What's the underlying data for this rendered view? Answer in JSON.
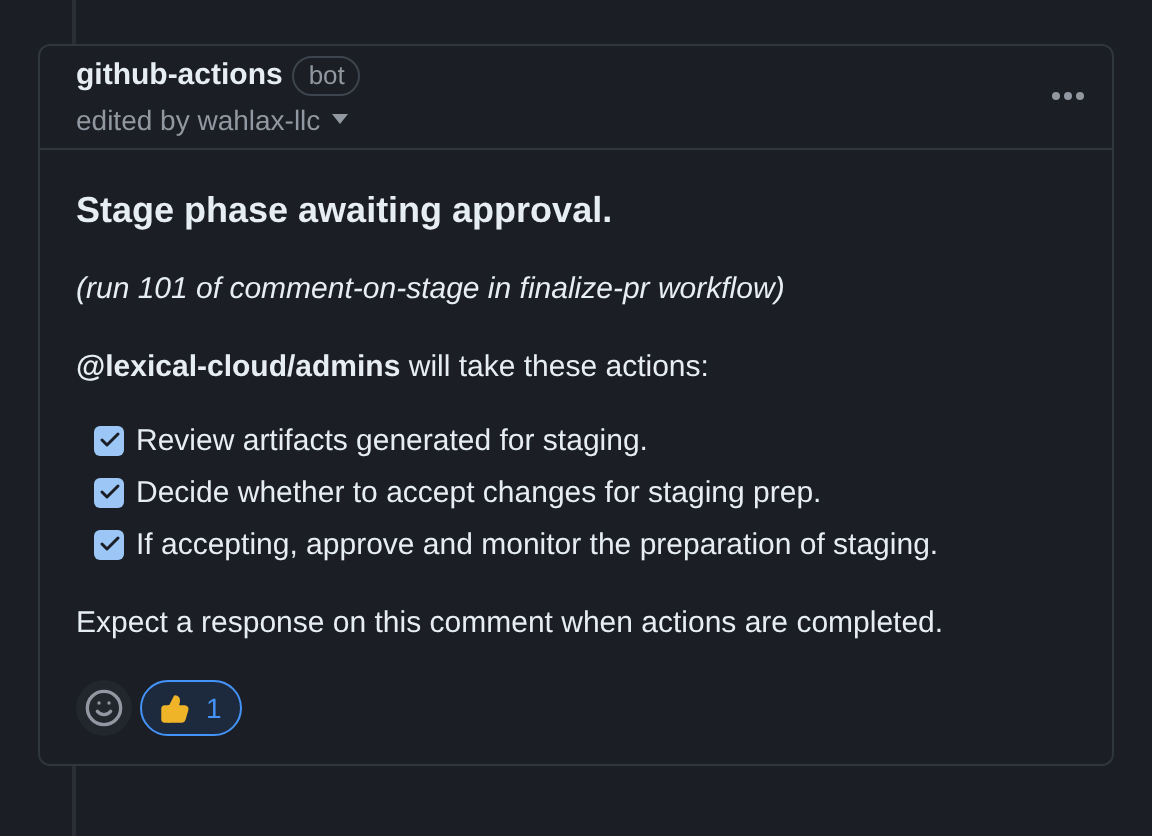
{
  "comment": {
    "author": "github-actions",
    "badge": "bot",
    "edited": "edited by wahlax-llc",
    "title": "Stage phase awaiting approval.",
    "run_note": "(run 101 of comment-on-stage in finalize-pr workflow)",
    "intro": "**@lexical-cloud/admins** will take these actions:",
    "tasks": [
      {
        "label": "Review artifacts generated for staging.",
        "checked": true
      },
      {
        "label": "Decide whether to accept changes for staging prep.",
        "checked": true
      },
      {
        "label": "If accepting, approve and monitor the preparation of staging.",
        "checked": true
      }
    ],
    "footer": "Expect a response on this comment when actions are completed.",
    "reactions": [
      {
        "count": "1",
        "selected": true
      }
    ]
  }
}
